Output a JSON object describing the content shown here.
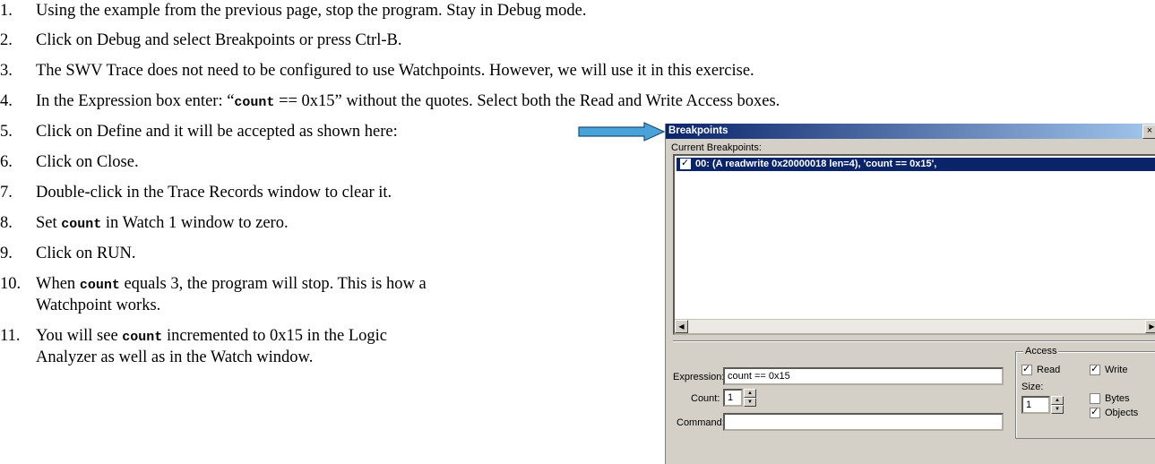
{
  "steps": [
    {
      "num": "1.",
      "parts": [
        "Using the example from the previous page, stop the program.  Stay in Debug mode."
      ]
    },
    {
      "num": "2.",
      "parts": [
        "Click on Debug and select Breakpoints or press Ctrl-B."
      ]
    },
    {
      "num": "3.",
      "parts": [
        "The SWV Trace does not need to be configured to use Watchpoints.  However, we will use it in this exercise."
      ]
    },
    {
      "num": "4.",
      "parts": [
        "In the Expression box enter:  “",
        "count",
        " == 0x15” without the quotes.  Select both the Read and Write Access boxes."
      ]
    },
    {
      "num": "5.",
      "parts": [
        "Click on Define and it will be accepted as shown here:"
      ]
    },
    {
      "num": "6.",
      "parts": [
        "Click on Close."
      ]
    },
    {
      "num": "7.",
      "parts": [
        "Double-click in the Trace Records window to clear it."
      ]
    },
    {
      "num": "8.",
      "parts": [
        "Set ",
        "count",
        " in Watch 1 window to zero."
      ]
    },
    {
      "num": "9.",
      "parts": [
        "Click on RUN."
      ]
    },
    {
      "num": "10.",
      "parts": [
        "When ",
        "count",
        " equals 3, the program will stop.  This is how a"
      ],
      "cont": "Watchpoint works."
    },
    {
      "num": "11.",
      "parts": [
        "You will see ",
        "count",
        " incremented to 0x15 in the Logic"
      ],
      "cont": "Analyzer as well as in the Watch window."
    }
  ],
  "dialog": {
    "title": "Breakpoints",
    "close_glyph": "×",
    "current_label": "Current Breakpoints:",
    "breakpoint_entry": "00: (A readwrite 0x20000018 len=4),  'count == 0x15',",
    "expression_label": "Expression:",
    "expression_value": "count == 0x15",
    "count_label": "Count:",
    "count_value": "1",
    "command_label": "Command:",
    "command_value": "",
    "access": {
      "title": "Access",
      "read_label": "Read",
      "read_checked": true,
      "write_label": "Write",
      "write_checked": true,
      "size_label": "Size:",
      "size_value": "1",
      "bytes_label": "Bytes",
      "bytes_checked": false,
      "objects_label": "Objects",
      "objects_checked": true
    }
  },
  "colors": {
    "arrow_fill": "#4aa3d8",
    "title_bar": "#0a246a",
    "dialog_bg": "#d4d0c8"
  }
}
